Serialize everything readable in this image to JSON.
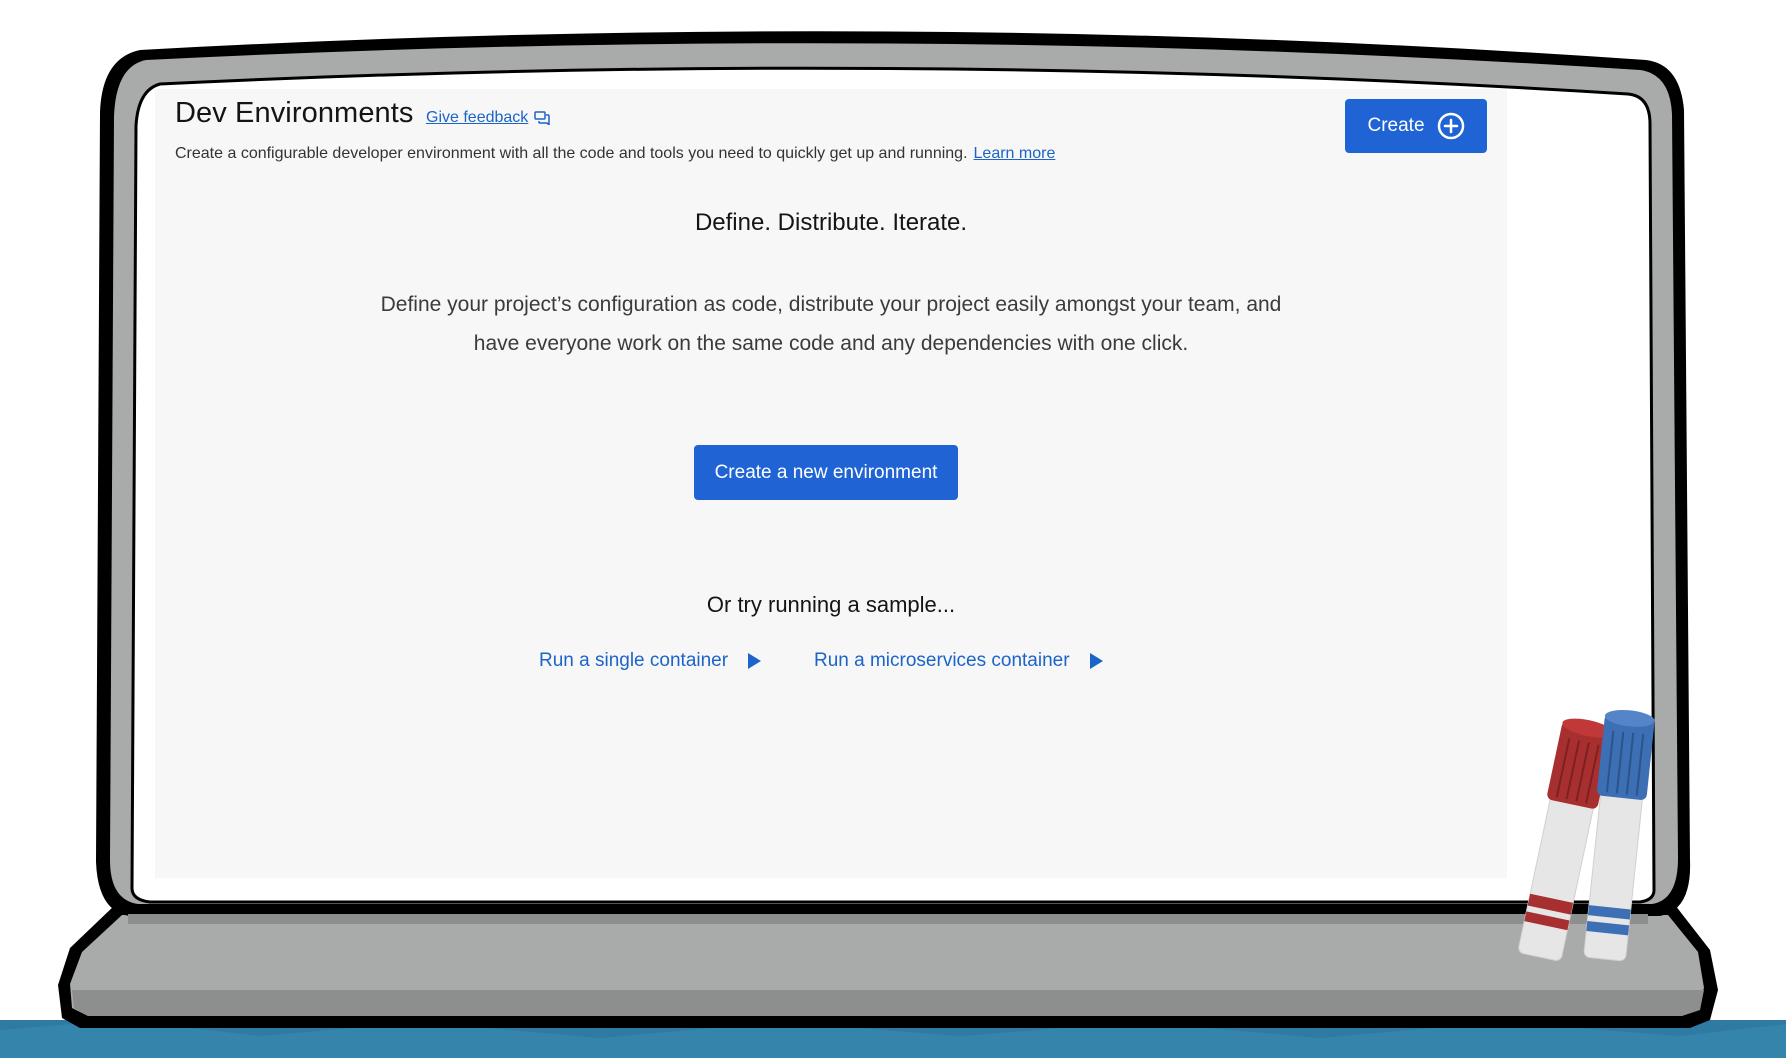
{
  "header": {
    "title": "Dev Environments",
    "feedback_label": "Give feedback",
    "feedback_icon": "chat-bubbles-icon",
    "subtitle": "Create a configurable developer environment with all the code and tools you need to quickly get up and running.",
    "learn_more": "Learn more",
    "create_label": "Create",
    "create_icon": "plus-circle-icon"
  },
  "main": {
    "headline": "Define. Distribute. Iterate.",
    "description_line1": "Define your project’s configuration as code, distribute your project easily amongst your team, and",
    "description_line2": "have everyone work on the same code and any dependencies with one click.",
    "new_env_label": "Create a new environment",
    "sample_heading": "Or try running a sample...",
    "samples": [
      {
        "label": "Run a single container",
        "icon": "play-icon"
      },
      {
        "label": "Run a microservices container",
        "icon": "play-icon"
      }
    ]
  },
  "colors": {
    "accent": "#1f63d5",
    "link": "#1c64c8",
    "panel_bg": "#f7f7f7",
    "frame_gray": "#a9abab",
    "marker_red": "#a82f2f",
    "marker_blue": "#3d6fb5"
  }
}
